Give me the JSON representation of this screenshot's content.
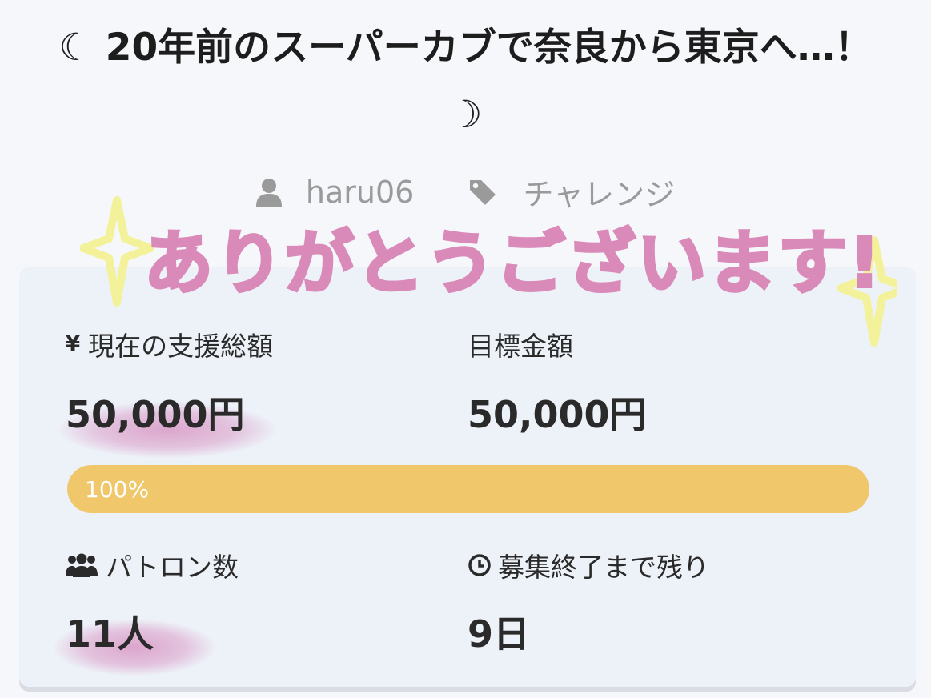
{
  "header": {
    "title": "☾ 20年前のスーパーカブで奈良から東京へ…！ ☽"
  },
  "meta": {
    "author": "haru06",
    "category": "チャレンジ",
    "author_icon": "user-icon",
    "category_icon": "tag-icon"
  },
  "overlay": {
    "text": "ありがとうございます!",
    "color": "#d98ab9",
    "sparkle_color": "#f3f29a"
  },
  "stats": {
    "current_total_label": "現在の支援総額",
    "current_total_value": "50,000円",
    "goal_label": "目標金額",
    "goal_value": "50,000円",
    "progress_text": "100%",
    "progress_percent": 100,
    "patrons_label": "パトロン数",
    "patrons_value": "11人",
    "remaining_label": "募集終了まで残り",
    "remaining_value": "9日"
  },
  "colors": {
    "progress_fill": "#f0c76b",
    "card_bg": "#edf1f8",
    "meta_text": "#9a9a9a"
  }
}
